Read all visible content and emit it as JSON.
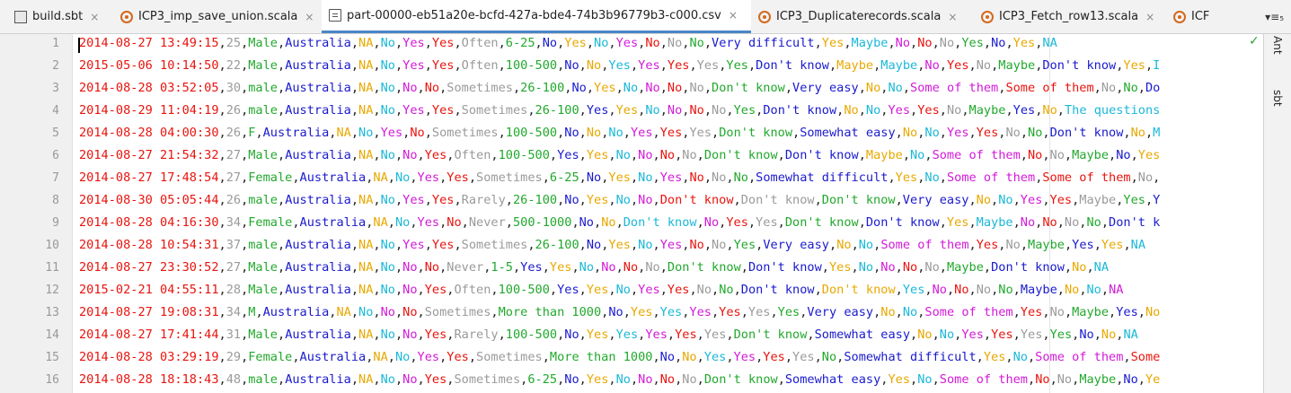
{
  "tabs": [
    {
      "label": "build.sbt",
      "icon": "sbt-file-icon"
    },
    {
      "label": "ICP3_imp_save_union.scala",
      "icon": "scala-file-icon"
    },
    {
      "label": "part-00000-eb51a20e-bcfd-427a-bde4-74b3b96779b3-c000.csv",
      "icon": "text-file-icon",
      "active": true
    },
    {
      "label": "ICP3_Duplicaterecords.scala",
      "icon": "scala-file-icon"
    },
    {
      "label": "ICP3_Fetch_row13.scala",
      "icon": "scala-file-icon"
    },
    {
      "label": "ICF",
      "icon": "scala-file-icon"
    }
  ],
  "tab_overflow": "▾≡₅",
  "close_glyph": "×",
  "right_tools": [
    "Ant",
    "sbt"
  ],
  "status_check": "✓",
  "palette": [
    "#e8140e",
    "#9a9a9a",
    "#22a82d",
    "#1a1acd",
    "#e8a800",
    "#1ab8d8",
    "#d21ad8"
  ],
  "lines": [
    "2014-08-27 13:49:15,25,Male,Australia,NA,No,Yes,Yes,Often,6-25,No,Yes,No,Yes,No,No,No,Very difficult,Yes,Maybe,No,No,No,Yes,No,Yes,NA",
    "2015-05-06 10:14:50,22,Male,Australia,NA,No,Yes,Yes,Often,100-500,No,No,Yes,Yes,Yes,Yes,Yes,Don't know,Maybe,Maybe,No,Yes,No,Maybe,Don't know,Yes,I",
    "2014-08-28 03:52:05,30,male,Australia,NA,No,No,No,Sometimes,26-100,No,Yes,No,No,No,No,Don't know,Very easy,No,No,Some of them,Some of them,No,No,Do",
    "2014-08-29 11:04:19,26,male,Australia,NA,No,Yes,Yes,Sometimes,26-100,Yes,Yes,No,No,No,No,Yes,Don't know,No,No,Yes,Yes,No,Maybe,Yes,No,The questions",
    "2014-08-28 04:00:30,26,F,Australia,NA,No,Yes,No,Sometimes,100-500,No,No,No,Yes,Yes,Yes,Don't know,Somewhat easy,No,No,Yes,Yes,No,No,Don't know,No,M",
    "2014-08-27 21:54:32,27,Male,Australia,NA,No,No,Yes,Often,100-500,Yes,Yes,No,No,No,No,Don't know,Don't know,Maybe,No,Some of them,No,No,Maybe,No,Yes",
    "2014-08-27 17:48:54,27,Female,Australia,NA,No,Yes,Yes,Sometimes,6-25,No,Yes,No,Yes,No,No,No,Somewhat difficult,Yes,No,Some of them,Some of them,No,",
    "2014-08-30 05:05:44,26,male,Australia,NA,No,Yes,Yes,Rarely,26-100,No,Yes,No,No,Don't know,Don't know,Don't know,Very easy,No,No,Yes,Yes,Maybe,Yes,Y",
    "2014-08-28 04:16:30,34,Female,Australia,NA,No,Yes,No,Never,500-1000,No,No,Don't know,No,Yes,Yes,Don't know,Don't know,Yes,Maybe,No,No,No,No,Don't k",
    "2014-08-28 10:54:31,37,male,Australia,NA,No,Yes,Yes,Sometimes,26-100,No,Yes,No,Yes,No,No,Yes,Very easy,No,No,Some of them,Yes,No,Maybe,Yes,Yes,NA",
    "2014-08-27 23:30:52,27,Male,Australia,NA,No,No,No,Never,1-5,Yes,Yes,No,No,No,No,Don't know,Don't know,Yes,No,No,No,No,Maybe,Don't know,No,NA",
    "2015-02-21 04:55:11,28,Male,Australia,NA,No,No,Yes,Often,100-500,Yes,Yes,No,Yes,Yes,No,No,Don't know,Don't know,Yes,No,No,No,No,Maybe,No,No,NA",
    "2014-08-27 19:08:31,34,M,Australia,NA,No,No,No,Sometimes,More than 1000,No,Yes,Yes,Yes,Yes,Yes,Yes,Very easy,No,No,Some of them,Yes,No,Maybe,Yes,No",
    "2014-08-27 17:41:44,31,Male,Australia,NA,No,No,Yes,Rarely,100-500,No,Yes,Yes,Yes,Yes,Yes,Don't know,Somewhat easy,No,No,Yes,Yes,Yes,Yes,No,No,NA",
    "2014-08-28 03:29:19,29,Female,Australia,NA,No,Yes,Yes,Sometimes,More than 1000,No,No,Yes,Yes,Yes,Yes,No,Somewhat difficult,Yes,No,Some of them,Some",
    "2014-08-28 18:18:43,48,male,Australia,NA,No,No,Yes,Sometimes,6-25,No,Yes,No,No,No,No,Don't know,Somewhat easy,Yes,No,Some of them,No,No,Maybe,No,Ye"
  ]
}
